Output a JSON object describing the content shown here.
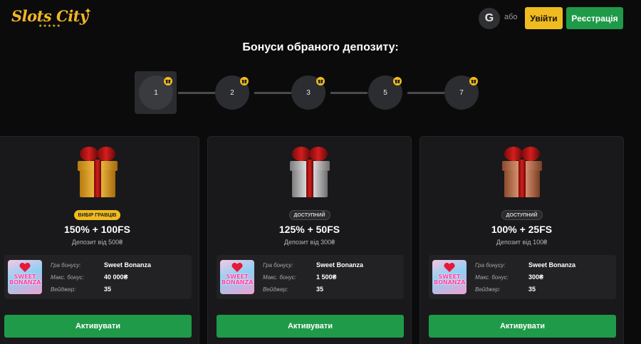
{
  "header": {
    "logo_text": "Slots City",
    "logo_stars": "★★★★★",
    "google_letter": "G",
    "or_text": "або",
    "login_label": "Увійти",
    "register_label": "Реєстрація"
  },
  "section_title": "Бонуси обраного депозиту:",
  "steps": [
    {
      "label": "1",
      "active": true
    },
    {
      "label": "2",
      "active": false
    },
    {
      "label": "3",
      "active": false
    },
    {
      "label": "5",
      "active": false
    },
    {
      "label": "7",
      "active": false
    }
  ],
  "cards": [
    {
      "gift_color": "gold",
      "badge": "Вибір гравців",
      "badge_style": "gold",
      "offer": "150% + 100FS",
      "deposit": "Депозит від 500₴",
      "game_label": "Гра бонусу:",
      "game_value": "Sweet Bonanza",
      "max_label": "Макс. бонус:",
      "max_value": "40 000₴",
      "wager_label": "Вейджер:",
      "wager_value": "35",
      "thumb_title": "SWEET BONANZA",
      "activate_label": "Активувати"
    },
    {
      "gift_color": "silver",
      "badge": "Доступний",
      "badge_style": "gray",
      "offer": "125% + 50FS",
      "deposit": "Депозит від 300₴",
      "game_label": "Гра бонусу:",
      "game_value": "Sweet Bonanza",
      "max_label": "Макс. бонус:",
      "max_value": "1 500₴",
      "wager_label": "Вейджер:",
      "wager_value": "35",
      "thumb_title": "SWEET BONANZA",
      "activate_label": "Активувати"
    },
    {
      "gift_color": "bronze",
      "badge": "Доступний",
      "badge_style": "gray",
      "offer": "100% + 25FS",
      "deposit": "Депозит від 100₴",
      "game_label": "Гра бонусу:",
      "game_value": "Sweet Bonanza",
      "max_label": "Макс. бонус:",
      "max_value": "300₴",
      "wager_label": "Вейджер:",
      "wager_value": "35",
      "thumb_title": "SWEET BONANZA",
      "activate_label": "Активувати"
    }
  ],
  "colors": {
    "accent_yellow": "#f0bb1e",
    "accent_green": "#1f9a48",
    "background": "#0b0b0c",
    "card": "#19191b"
  }
}
